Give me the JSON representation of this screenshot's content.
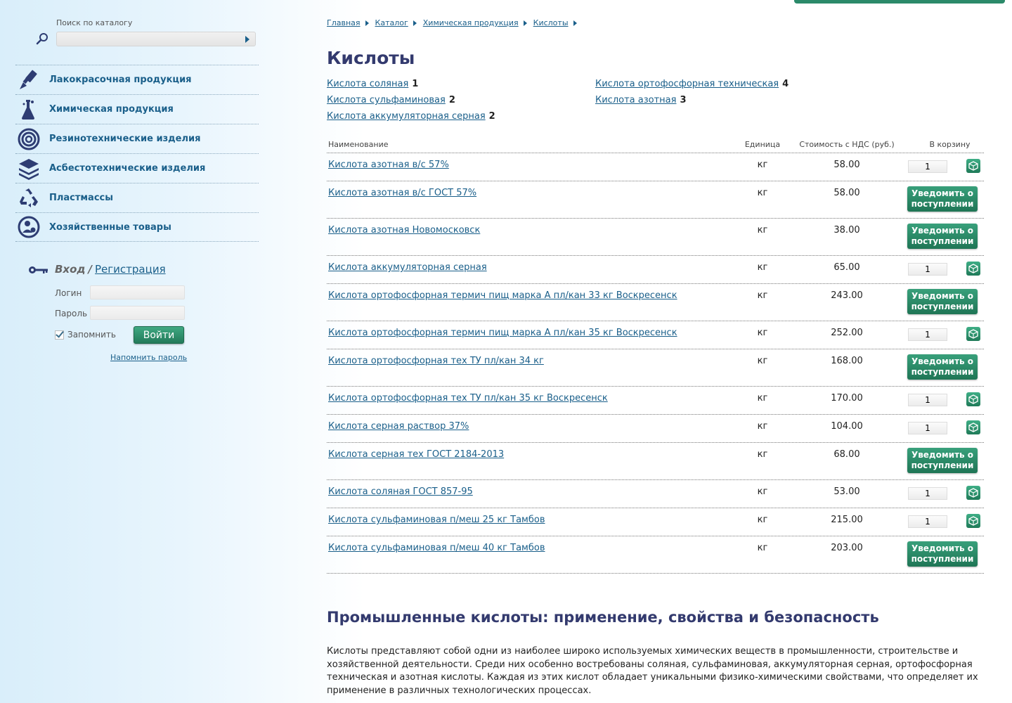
{
  "search": {
    "label": "Поиск по каталогу",
    "placeholder": ""
  },
  "categories": [
    {
      "label": "Лакокрасочная продукция",
      "icon": "paint-brush-icon"
    },
    {
      "label": "Химическая продукция",
      "icon": "flask-icon"
    },
    {
      "label": "Резинотехнические изделия",
      "icon": "rubber-coil-icon"
    },
    {
      "label": "Асбестотехнические изделия",
      "icon": "layers-icon"
    },
    {
      "label": "Пластмассы",
      "icon": "recycle-icon"
    },
    {
      "label": "Хозяйственные товары",
      "icon": "household-icon"
    }
  ],
  "login": {
    "title": "Вход",
    "separator": "/",
    "register_label": "Регистрация",
    "login_label": "Логин",
    "password_label": "Пароль",
    "remember_label": "Запомнить",
    "submit_label": "Войти",
    "remind_label": "Напомнить пароль"
  },
  "breadcrumb": [
    "Главная",
    "Каталог",
    "Химическая продукция",
    "Кислоты"
  ],
  "page_title": "Кислоты",
  "subcategories": [
    {
      "label": "Кислота соляная",
      "count": "1"
    },
    {
      "label": "Кислота сульфаминовая",
      "count": "2"
    },
    {
      "label": "Кислота аккумуляторная серная",
      "count": "2"
    },
    {
      "label": "Кислота ортофосфорная техническая",
      "count": "4"
    },
    {
      "label": "Кислота азотная",
      "count": "3"
    }
  ],
  "table": {
    "headers": {
      "name": "Наименование",
      "unit": "Единица",
      "price": "Стоимость с НДС (руб.)",
      "cart": "В корзину"
    },
    "notify_label": "Уведомить о поступлении",
    "rows": [
      {
        "name": "Кислота азотная в/с 57%",
        "unit": "кг",
        "price": "58.00",
        "available": true,
        "qty": "1"
      },
      {
        "name": "Кислота азотная в/с ГОСТ 57%",
        "unit": "кг",
        "price": "58.00",
        "available": false
      },
      {
        "name": "Кислота азотная Новомосковск",
        "unit": "кг",
        "price": "38.00",
        "available": false
      },
      {
        "name": "Кислота аккумуляторная серная",
        "unit": "кг",
        "price": "65.00",
        "available": true,
        "qty": "1"
      },
      {
        "name": "Кислота ортофосфорная термич пищ марка А пл/кан 33 кг Воскресенск",
        "unit": "кг",
        "price": "243.00",
        "available": false
      },
      {
        "name": "Кислота ортофосфорная термич пищ марка А пл/кан 35 кг Воскресенск",
        "unit": "кг",
        "price": "252.00",
        "available": true,
        "qty": "1"
      },
      {
        "name": "Кислота ортофосфорная тех ТУ пл/кан 34 кг",
        "unit": "кг",
        "price": "168.00",
        "available": false
      },
      {
        "name": "Кислота ортофосфорная тех ТУ пл/кан 35 кг Воскресенск",
        "unit": "кг",
        "price": "170.00",
        "available": true,
        "qty": "1"
      },
      {
        "name": "Кислота серная раствор 37%",
        "unit": "кг",
        "price": "104.00",
        "available": true,
        "qty": "1"
      },
      {
        "name": "Кислота серная тех ГОСТ 2184-2013",
        "unit": "кг",
        "price": "68.00",
        "available": false
      },
      {
        "name": "Кислота соляная ГОСТ 857-95",
        "unit": "кг",
        "price": "53.00",
        "available": true,
        "qty": "1"
      },
      {
        "name": "Кислота сульфаминовая п/меш 25 кг Тамбов",
        "unit": "кг",
        "price": "215.00",
        "available": true,
        "qty": "1"
      },
      {
        "name": "Кислота сульфаминовая п/меш 40 кг Тамбов",
        "unit": "кг",
        "price": "203.00",
        "available": false
      }
    ]
  },
  "article": {
    "title": "Промышленные кислоты: применение, свойства и безопасность",
    "body": "Кислоты представляют собой одни из наиболее широко используемых химических веществ в промышленности, строительстве и хозяйственной деятельности. Среди них особенно востребованы соляная, сульфаминовая, аккумуляторная серная, ортофосфорная техническая и азотная кислоты. Каждая из этих кислот обладает уникальными физико-химическими свойствами, что определяет их применение в различных технологических процессах."
  },
  "colors": {
    "link": "#1a5f8a",
    "title": "#333a6e",
    "accent_green": "#2b8a6a",
    "icon_navy": "#2e3d73"
  }
}
